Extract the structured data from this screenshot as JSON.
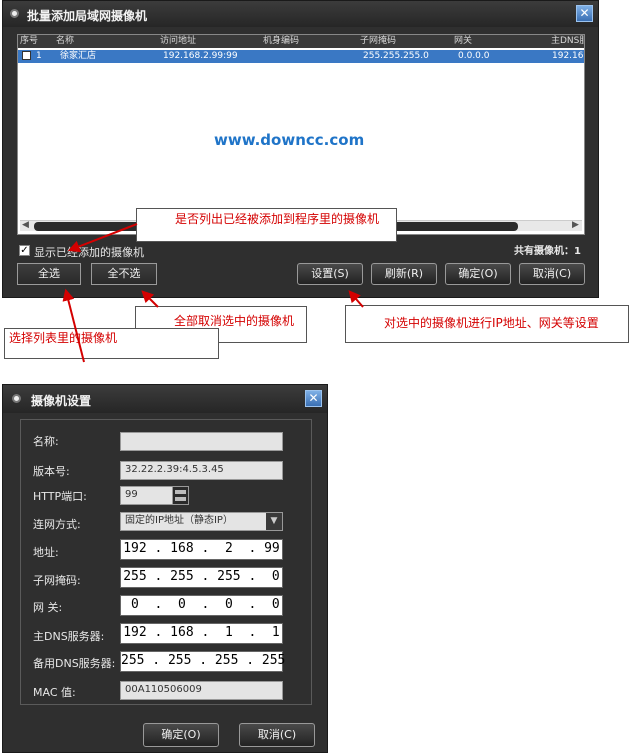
{
  "window1": {
    "title": "批量添加局域网摄像机",
    "columns": [
      "序号",
      "名称",
      "访问地址",
      "机身编码",
      "子网掩码",
      "网关",
      "主DNS服"
    ],
    "row": {
      "index": "1",
      "name": "徐家汇店",
      "address": "192.168.2.99:99",
      "serial": "",
      "mask": "255.255.255.0",
      "gateway": "0.0.0.0",
      "dns": "192.16"
    },
    "watermark": "www.downcc.com",
    "show_added_checkbox_label": "显示已经添加的摄像机",
    "total_label": "共有摄像机：1",
    "buttons": {
      "select_all": "全选",
      "deselect_all": "全不选",
      "settings": "设置(S)",
      "refresh": "刷新(R)",
      "ok": "确定(O)",
      "cancel": "取消(C)"
    }
  },
  "annotations": {
    "show_added": "是否列出已经被添加到程序里的摄像机",
    "deselect_all": "全部取消选中的摄像机",
    "select_all": "选择列表里的摄像机",
    "settings": "对选中的摄像机进行IP地址、网关等设置"
  },
  "window2": {
    "title": "摄像机设置",
    "fields": {
      "name_label": "名称:",
      "name_value": "",
      "version_label": "版本号:",
      "version_value": "32.22.2.39:4.5.3.45",
      "http_label": "HTTP端口:",
      "http_value": "99",
      "net_label": "连网方式:",
      "net_value": "固定的IP地址（静态IP）",
      "addr_label": "地址:",
      "addr_value": "192 . 168 .  2  . 99",
      "mask_label": "子网掩码:",
      "mask_value": "255 . 255 . 255 .  0",
      "gw_label": "网  关:",
      "gw_value": " 0  .  0  .  0  .  0",
      "dns1_label": "主DNS服务器:",
      "dns1_value": "192 . 168 .  1  .  1",
      "dns2_label": "备用DNS服务器:",
      "dns2_value": "255 . 255 . 255 . 255",
      "mac_label": "MAC  值:",
      "mac_value": "00A110506009"
    },
    "buttons": {
      "ok": "确定(O)",
      "cancel": "取消(C)"
    }
  },
  "colors": {
    "window_bg": "#2f2f2f",
    "selection": "#3a78c4",
    "annotation_text": "#d40000",
    "watermark": "#1f74c8"
  }
}
